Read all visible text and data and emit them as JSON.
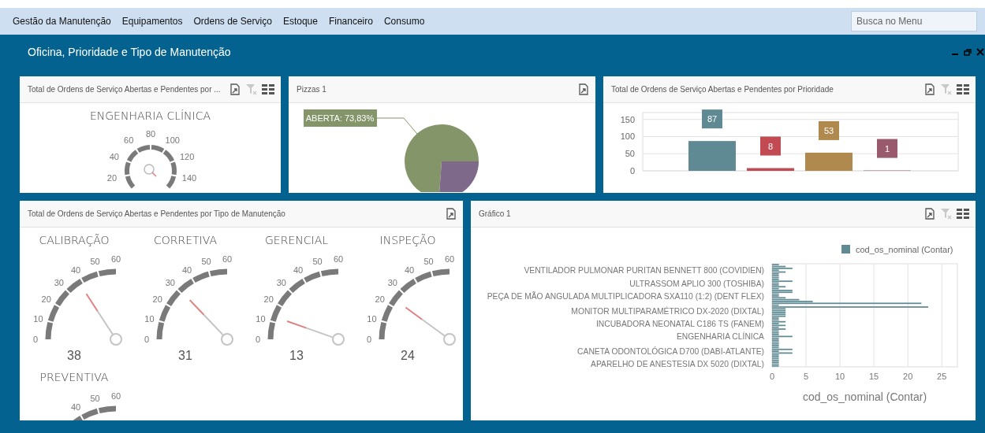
{
  "menu": {
    "items": [
      "Gestão da Manutenção",
      "Equipamentos",
      "Ordens de Serviço",
      "Estoque",
      "Financeiro",
      "Consumo"
    ],
    "search": {
      "placeholder": "Busca no Menu"
    }
  },
  "window": {
    "title": "Oficina, Prioridade e Tipo de Manutenção"
  },
  "panels": [
    {
      "kind": "circle-gauge",
      "title": "Total de Ordens de Serviço Abertas e Pendentes por ...",
      "tools": [
        {
          "kind": "export"
        },
        {
          "kind": "clear-filter"
        },
        {
          "kind": "layout"
        }
      ],
      "gauge": {
        "title": "ENGENHARIA CLÍNICA",
        "ticks": [
          "20",
          "40",
          "60",
          "80",
          "100",
          "120",
          "140"
        ]
      }
    },
    {
      "kind": "pie",
      "title": "Pizzas 1",
      "tools": [
        {
          "kind": "export"
        }
      ],
      "chart_data": {
        "type": "pie",
        "values": [
          73.83,
          26.17
        ],
        "colors": [
          "#84956a",
          "#7e698b"
        ],
        "annotations": [
          "ABERTA: 73,83%"
        ]
      }
    },
    {
      "kind": "chart",
      "title": "Total de Ordens de Serviço Abertas e Pendentes por Prioridade",
      "tools": [
        {
          "kind": "export"
        },
        {
          "kind": "clear-filter"
        },
        {
          "kind": "layout"
        }
      ],
      "chart_data": {
        "type": "bar",
        "yticks": [
          0,
          50,
          100,
          150
        ],
        "ylim": [
          0,
          170
        ],
        "grid": true,
        "data_labels": true,
        "series": [
          {
            "values": [
              87,
              8,
              53,
              1
            ]
          }
        ],
        "colors": [
          "#5f8a93",
          "#c24a53",
          "#b0894f",
          "#9a5a6d"
        ]
      }
    },
    {
      "kind": "gauges",
      "title": "Total de Ordens de Serviço Abertas e Pendentes por Tipo de Manutenção",
      "tools": [
        {
          "kind": "export"
        }
      ],
      "gauges": [
        {
          "title": "CALIBRAÇÃO",
          "ticks": [
            "0",
            "10",
            "20",
            "30",
            "40",
            "50",
            "60"
          ],
          "value": "38"
        },
        {
          "title": "CORRETIVA",
          "ticks": [
            "0",
            "10",
            "20",
            "30",
            "40",
            "50",
            "60"
          ],
          "value": "31"
        },
        {
          "title": "GERENCIAL",
          "ticks": [
            "0",
            "10",
            "20",
            "30",
            "40",
            "50",
            "60"
          ],
          "value": "13"
        },
        {
          "title": "INSPEÇÃO",
          "ticks": [
            "0",
            "10",
            "20",
            "30",
            "40",
            "50",
            "60"
          ],
          "value": "24"
        },
        {
          "title": "PREVENTIVA",
          "ticks": [
            "40",
            "50",
            "60"
          ]
        }
      ]
    },
    {
      "kind": "chart",
      "title": "Gráfico 1",
      "tools": [
        {
          "kind": "export"
        },
        {
          "kind": "clear-filter"
        },
        {
          "kind": "layout"
        }
      ],
      "chart_data": {
        "type": "bar",
        "orientation": "horizontal",
        "xlabel": "cod_os_nominal (Contar)",
        "xticks": [
          0,
          5,
          10,
          15,
          20,
          25
        ],
        "xlim": [
          0,
          27.3
        ],
        "grid": true,
        "categories": [
          null,
          null,
          null,
          "VENTILADOR PULMONAR PURITAN BENNETT 800 (COVIDIEN)",
          null,
          null,
          null,
          null,
          null,
          null,
          "ULTRASSOM APLIO 300 (TOSHIBA)",
          null,
          null,
          null,
          null,
          null,
          null,
          "PEÇA DE MÃO ANGULADA MULTIPLICADORA SXA110 (1:2) (DENT FLEX)",
          null,
          null,
          null,
          null,
          null,
          null,
          null,
          "MONITOR MULTIPARAMÉTRICO DX-2020 (DIXTAL)",
          null,
          null,
          null,
          null,
          null,
          null,
          "INCUBADORA NEONATAL C186 TS (FANEM)",
          null,
          null,
          null,
          null,
          null,
          null,
          "ENGENHARIA CLÍNICA",
          null,
          null,
          null,
          null,
          null,
          null,
          null,
          "CANETA ODONTOLÓGICA D700 (DABI-ATLANTE)",
          null,
          null,
          null,
          null,
          null,
          null,
          "APARELHO DE ANESTESIA DX 5020 (DIXTAL)",
          null
        ],
        "series": [
          {
            "name": "cod_os_nominal (Contar)",
            "color": "#5f8a93",
            "values": [
              1,
              2,
              3,
              1,
              2,
              1,
              1,
              1,
              1,
              3,
              1,
              1,
              2,
              1,
              3,
              3,
              1,
              1,
              2,
              4,
              6,
              22,
              1,
              23,
              2,
              2,
              2,
              2,
              2,
              1,
              1,
              2,
              1,
              2,
              1,
              2,
              1,
              1,
              1,
              3,
              1,
              1,
              1,
              1,
              1,
              1,
              3,
              1,
              3,
              1,
              1,
              1,
              1,
              1,
              1,
              1
            ]
          }
        ]
      }
    }
  ]
}
